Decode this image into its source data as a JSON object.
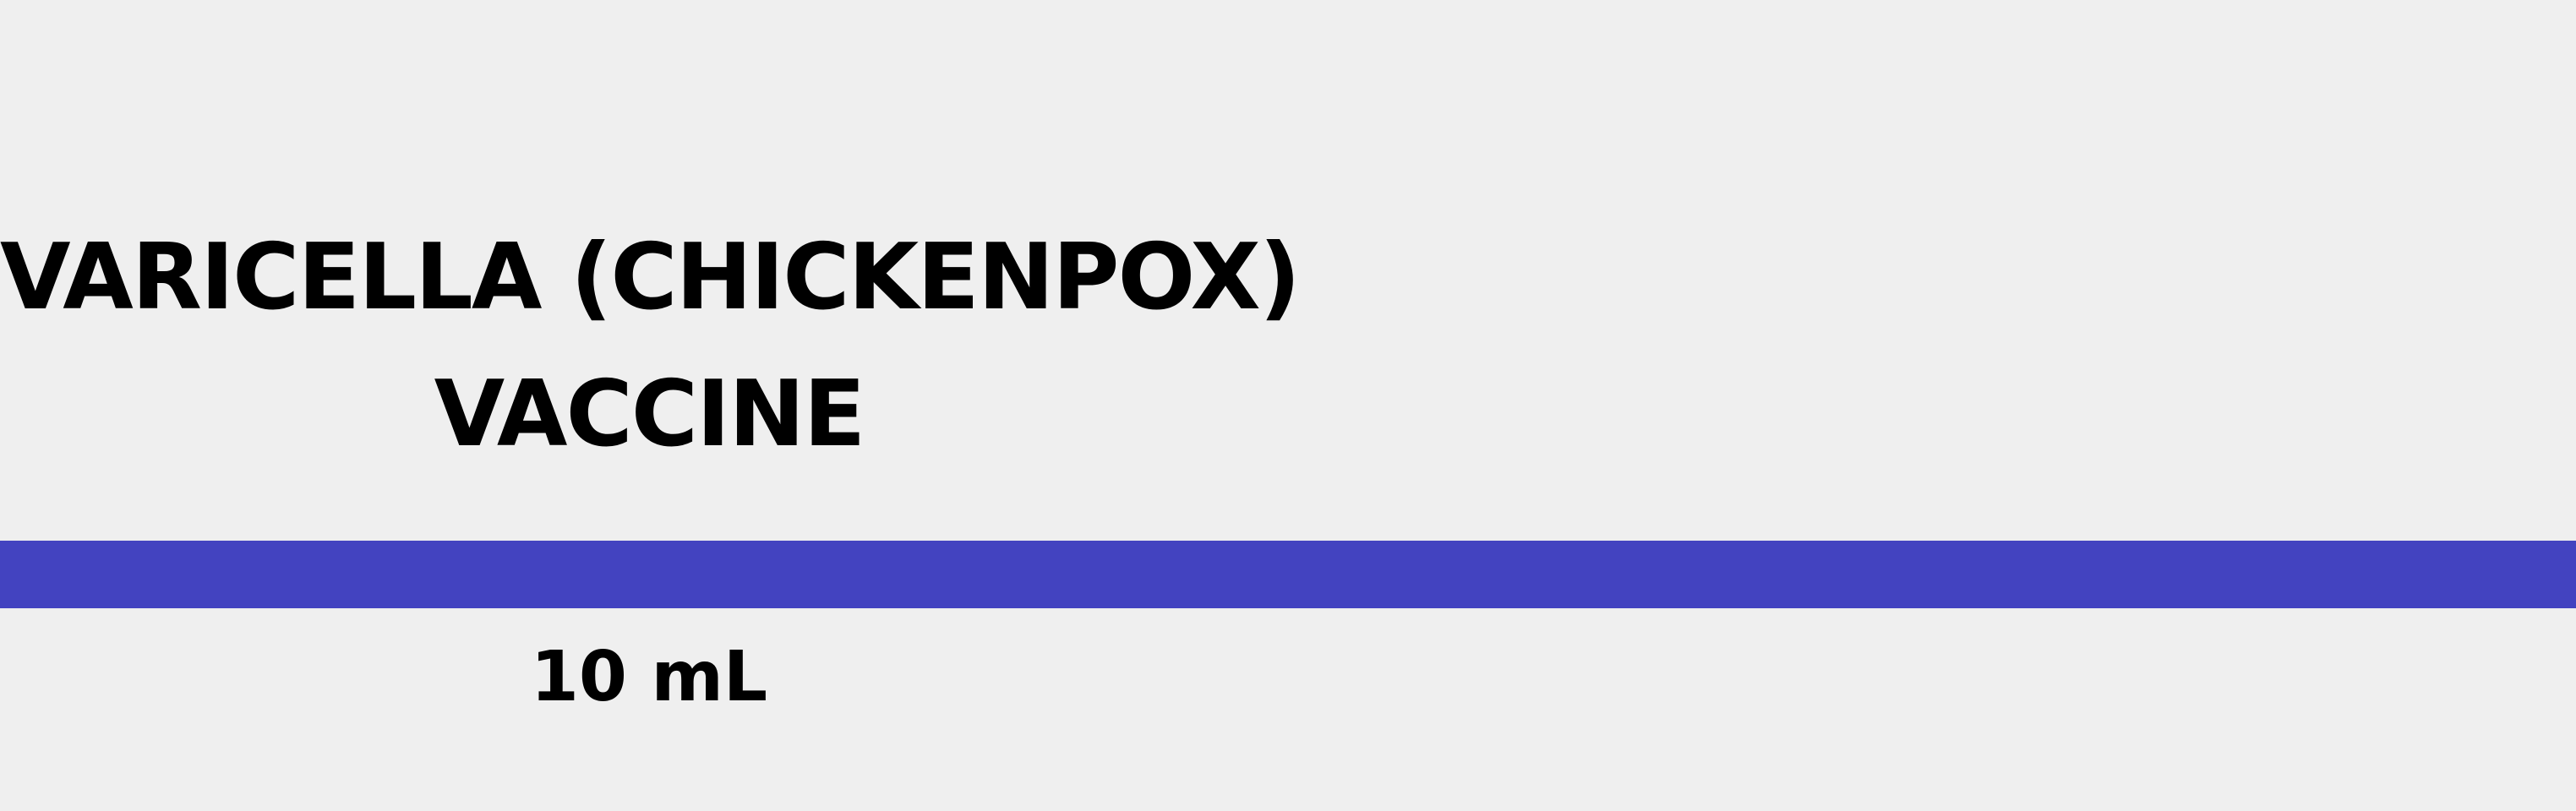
{
  "label": {
    "title_line_1": "VARICELLA (CHICKENPOX)",
    "title_line_2": "VACCINE",
    "volume": "10 mL",
    "band_color": "#4343c0",
    "background_color": "#efefef"
  }
}
